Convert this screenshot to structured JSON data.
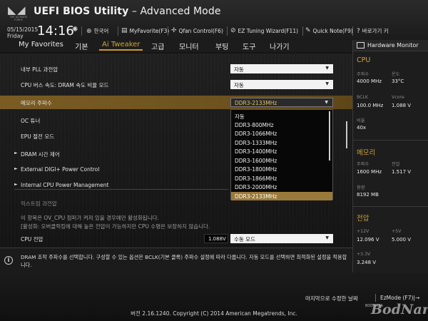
{
  "header": {
    "logo_text": "THE ULTIMATE FORCE",
    "title_bold": "UEFI BIOS Utility",
    "title_rest": " – Advanced Mode",
    "date": "05/15/2015",
    "day": "Friday",
    "time": "14:16",
    "items": [
      {
        "label": "한국어",
        "icon": "globe-icon"
      },
      {
        "label": "MyFavorite(F3)",
        "icon": "favorite-icon"
      },
      {
        "label": "Qfan Control(F6)",
        "icon": "fan-icon"
      },
      {
        "label": "EZ Tuning Wizard(F11)",
        "icon": "wizard-icon"
      },
      {
        "label": "Quick Note(F9)",
        "icon": "note-icon"
      },
      {
        "label": "바로가기 키",
        "icon": "help-icon"
      }
    ]
  },
  "nav": {
    "tabs": [
      "My Favorites",
      "기본",
      "Ai Tweaker",
      "고급",
      "모니터",
      "부팅",
      "도구",
      "나가기"
    ],
    "active_index": 2
  },
  "settings": {
    "pll": {
      "label": "내부 PLL 과전압",
      "value": "자동"
    },
    "bus": {
      "label": "CPU 버스 속도: DRAM 속도 비율 모드",
      "value": "자동"
    },
    "mem": {
      "label": "메모리 주파수",
      "value": "DDR3-2133MHz"
    },
    "oc": {
      "label": "OC 튜너"
    },
    "epu": {
      "label": "EPU 절전 모드"
    },
    "dram_timing": {
      "label": "DRAM 시간 제어"
    },
    "digi": {
      "label": "External DIGI+ Power Control"
    },
    "cpu_power": {
      "label": "Internal CPU Power Management"
    },
    "extreme": {
      "label": "익스트림 과전압"
    },
    "note1": "이 항목은 OV_CPU 점퍼가 켜져 있을 경우에만 활성화됩니다.",
    "note2": "[활성화: 오버클럭킹에 대해 높은 전압이 가능하지만 CPU 수명은 보장하지 않습니다.",
    "cpu_voltage": {
      "label": "CPU 전압",
      "reading": "1.088V",
      "value": "수동 모드"
    }
  },
  "dropdown": {
    "options": [
      "자동",
      "DDR3-800MHz",
      "DDR3-1066MHz",
      "DDR3-1333MHz",
      "DDR3-1400MHz",
      "DDR3-1600MHz",
      "DDR3-1800MHz",
      "DDR3-1866MHz",
      "DDR3-2000MHz",
      "DDR3-2133MHz"
    ],
    "selected_index": 9
  },
  "help": {
    "text": "DRAM 조작 주파수를 선택합니다. 구성할 수 있는 옵션은 BCLK(기본 클록) 주파수 설정에 따라 다릅니다. 자동 모드를 선택하면 최적화된 설정을 적용합니다."
  },
  "monitor": {
    "title": "Hardware Monitor",
    "cpu": {
      "title": "CPU",
      "freq_label": "주파수",
      "freq": "4000 MHz",
      "temp_label": "온도",
      "temp": "33°C",
      "bclk_label": "BCLK",
      "bclk": "100.0 MHz",
      "vcore_label": "Vcore",
      "vcore": "1.088 V",
      "ratio_label": "비율",
      "ratio": "40x"
    },
    "memory": {
      "title": "메모리",
      "freq_label": "주파수",
      "freq": "1600 MHz",
      "volt_label": "전압",
      "volt": "1.517 V",
      "cap_label": "용량",
      "cap": "8192 MB"
    },
    "voltage": {
      "title": "전압",
      "v12_label": "+12V",
      "v12": "12.096 V",
      "v5_label": "+5V",
      "v5": "5.000 V",
      "v33_label": "+3.3V",
      "v33": "3.248 V"
    }
  },
  "footer": {
    "last_modified": "마지막으로 수정한 날짜",
    "ezmode": "EzMode (F7)|→",
    "version": "버전 2.16.1240. Copyright (C) 2014 American Megatrends, Inc.",
    "watermark_small": "BODNARA",
    "watermark": "BodNara"
  },
  "colors": {
    "accent": "#d0a23a",
    "highlight_row": "#6e531f",
    "selected_option": "#9a7a3a"
  }
}
